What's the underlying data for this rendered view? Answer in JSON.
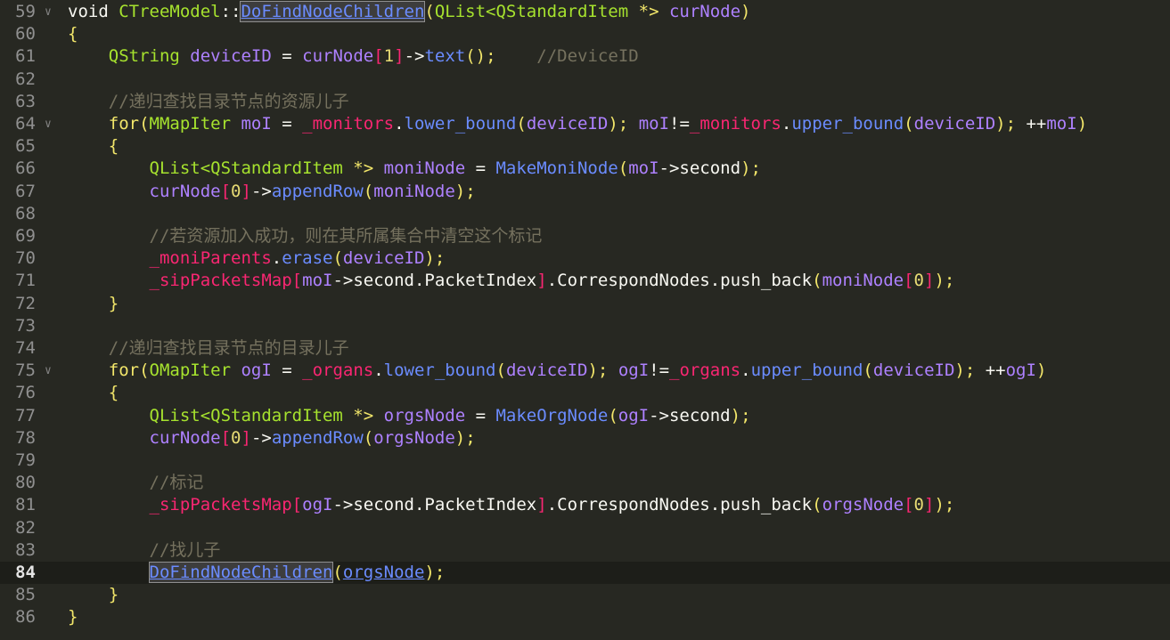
{
  "current_line": 84,
  "lines": [
    {
      "n": "59",
      "fold": true,
      "tokens": [
        [
          "kw",
          "void "
        ],
        [
          "type",
          "CTreeModel"
        ],
        [
          "op",
          "::"
        ],
        [
          "sel",
          "DoFindNodeChildren"
        ],
        [
          "flow",
          "("
        ],
        [
          "type",
          "QList<QStandardItem "
        ],
        [
          "flow",
          "*> "
        ],
        [
          "var",
          "curNode"
        ],
        [
          "flow",
          ")"
        ]
      ]
    },
    {
      "n": "60",
      "tokens": [
        [
          "flow",
          "{"
        ]
      ]
    },
    {
      "n": "61",
      "tokens": [
        [
          "plain",
          "    "
        ],
        [
          "type",
          "QString "
        ],
        [
          "var",
          "deviceID"
        ],
        [
          "op",
          " = "
        ],
        [
          "var",
          "curNode"
        ],
        [
          "mem",
          "["
        ],
        [
          "num",
          "1"
        ],
        [
          "mem",
          "]"
        ],
        [
          "op",
          "->"
        ],
        [
          "fn",
          "text"
        ],
        [
          "flow",
          "();"
        ],
        [
          "cm",
          "    //DeviceID"
        ]
      ]
    },
    {
      "n": "62",
      "tokens": []
    },
    {
      "n": "63",
      "tokens": [
        [
          "plain",
          "    "
        ],
        [
          "cm",
          "//递归查找目录节点的资源儿子"
        ]
      ]
    },
    {
      "n": "64",
      "fold": true,
      "tokens": [
        [
          "plain",
          "    "
        ],
        [
          "flow",
          "for("
        ],
        [
          "type",
          "MMapIter "
        ],
        [
          "var",
          "moI"
        ],
        [
          "op",
          " = "
        ],
        [
          "mem",
          "_monitors"
        ],
        [
          "op",
          "."
        ],
        [
          "fn",
          "lower_bound"
        ],
        [
          "flow",
          "("
        ],
        [
          "var",
          "deviceID"
        ],
        [
          "flow",
          ");"
        ],
        [
          "op",
          " "
        ],
        [
          "var",
          "moI"
        ],
        [
          "op",
          "!="
        ],
        [
          "mem",
          "_monitors"
        ],
        [
          "op",
          "."
        ],
        [
          "fn",
          "upper_bound"
        ],
        [
          "flow",
          "("
        ],
        [
          "var",
          "deviceID"
        ],
        [
          "flow",
          ");"
        ],
        [
          "op",
          " ++"
        ],
        [
          "var",
          "moI"
        ],
        [
          "flow",
          ")"
        ]
      ]
    },
    {
      "n": "65",
      "tokens": [
        [
          "plain",
          "    "
        ],
        [
          "flow",
          "{"
        ]
      ]
    },
    {
      "n": "66",
      "tokens": [
        [
          "plain",
          "        "
        ],
        [
          "type",
          "QList<QStandardItem "
        ],
        [
          "flow",
          "*> "
        ],
        [
          "var",
          "moniNode"
        ],
        [
          "op",
          " = "
        ],
        [
          "fn",
          "MakeMoniNode"
        ],
        [
          "flow",
          "("
        ],
        [
          "var",
          "moI"
        ],
        [
          "op",
          "->"
        ],
        [
          "plain",
          "second"
        ],
        [
          "flow",
          ");"
        ]
      ]
    },
    {
      "n": "67",
      "tokens": [
        [
          "plain",
          "        "
        ],
        [
          "var",
          "curNode"
        ],
        [
          "mem",
          "["
        ],
        [
          "num",
          "0"
        ],
        [
          "mem",
          "]"
        ],
        [
          "op",
          "->"
        ],
        [
          "fn",
          "appendRow"
        ],
        [
          "flow",
          "("
        ],
        [
          "var",
          "moniNode"
        ],
        [
          "flow",
          ");"
        ]
      ]
    },
    {
      "n": "68",
      "tokens": []
    },
    {
      "n": "69",
      "tokens": [
        [
          "plain",
          "        "
        ],
        [
          "cm",
          "//若资源加入成功，则在其所属集合中清空这个标记"
        ]
      ]
    },
    {
      "n": "70",
      "tokens": [
        [
          "plain",
          "        "
        ],
        [
          "mem",
          "_moniParents"
        ],
        [
          "op",
          "."
        ],
        [
          "fn",
          "erase"
        ],
        [
          "flow",
          "("
        ],
        [
          "var",
          "deviceID"
        ],
        [
          "flow",
          ");"
        ]
      ]
    },
    {
      "n": "71",
      "tokens": [
        [
          "plain",
          "        "
        ],
        [
          "mem",
          "_sipPacketsMap"
        ],
        [
          "mem",
          "["
        ],
        [
          "var",
          "moI"
        ],
        [
          "op",
          "->"
        ],
        [
          "plain",
          "second.PacketIndex"
        ],
        [
          "mem",
          "]"
        ],
        [
          "plain",
          ".CorrespondNodes.push_back"
        ],
        [
          "flow",
          "("
        ],
        [
          "var",
          "moniNode"
        ],
        [
          "mem",
          "["
        ],
        [
          "num",
          "0"
        ],
        [
          "mem",
          "]"
        ],
        [
          "flow",
          ");"
        ]
      ]
    },
    {
      "n": "72",
      "tokens": [
        [
          "plain",
          "    "
        ],
        [
          "flow",
          "}"
        ]
      ]
    },
    {
      "n": "73",
      "tokens": []
    },
    {
      "n": "74",
      "tokens": [
        [
          "plain",
          "    "
        ],
        [
          "cm",
          "//递归查找目录节点的目录儿子"
        ]
      ]
    },
    {
      "n": "75",
      "fold": true,
      "tokens": [
        [
          "plain",
          "    "
        ],
        [
          "flow",
          "for("
        ],
        [
          "type",
          "OMapIter "
        ],
        [
          "var",
          "ogI"
        ],
        [
          "op",
          " = "
        ],
        [
          "mem",
          "_organs"
        ],
        [
          "op",
          "."
        ],
        [
          "fn",
          "lower_bound"
        ],
        [
          "flow",
          "("
        ],
        [
          "var",
          "deviceID"
        ],
        [
          "flow",
          ");"
        ],
        [
          "op",
          " "
        ],
        [
          "var",
          "ogI"
        ],
        [
          "op",
          "!="
        ],
        [
          "mem",
          "_organs"
        ],
        [
          "op",
          "."
        ],
        [
          "fn",
          "upper_bound"
        ],
        [
          "flow",
          "("
        ],
        [
          "var",
          "deviceID"
        ],
        [
          "flow",
          ");"
        ],
        [
          "op",
          " ++"
        ],
        [
          "var",
          "ogI"
        ],
        [
          "flow",
          ")"
        ]
      ]
    },
    {
      "n": "76",
      "tokens": [
        [
          "plain",
          "    "
        ],
        [
          "flow",
          "{"
        ]
      ]
    },
    {
      "n": "77",
      "tokens": [
        [
          "plain",
          "        "
        ],
        [
          "type",
          "QList<QStandardItem "
        ],
        [
          "flow",
          "*> "
        ],
        [
          "var",
          "orgsNode"
        ],
        [
          "op",
          " = "
        ],
        [
          "fn",
          "MakeOrgNode"
        ],
        [
          "flow",
          "("
        ],
        [
          "var",
          "ogI"
        ],
        [
          "op",
          "->"
        ],
        [
          "plain",
          "second"
        ],
        [
          "flow",
          ");"
        ]
      ]
    },
    {
      "n": "78",
      "tokens": [
        [
          "plain",
          "        "
        ],
        [
          "var",
          "curNode"
        ],
        [
          "mem",
          "["
        ],
        [
          "num",
          "0"
        ],
        [
          "mem",
          "]"
        ],
        [
          "op",
          "->"
        ],
        [
          "fn",
          "appendRow"
        ],
        [
          "flow",
          "("
        ],
        [
          "var",
          "orgsNode"
        ],
        [
          "flow",
          ");"
        ]
      ]
    },
    {
      "n": "79",
      "tokens": []
    },
    {
      "n": "80",
      "tokens": [
        [
          "plain",
          "        "
        ],
        [
          "cm",
          "//标记"
        ]
      ]
    },
    {
      "n": "81",
      "tokens": [
        [
          "plain",
          "        "
        ],
        [
          "mem",
          "_sipPacketsMap"
        ],
        [
          "mem",
          "["
        ],
        [
          "var",
          "ogI"
        ],
        [
          "op",
          "->"
        ],
        [
          "plain",
          "second.PacketIndex"
        ],
        [
          "mem",
          "]"
        ],
        [
          "plain",
          ".CorrespondNodes.push_back"
        ],
        [
          "flow",
          "("
        ],
        [
          "var",
          "orgsNode"
        ],
        [
          "mem",
          "["
        ],
        [
          "num",
          "0"
        ],
        [
          "mem",
          "]"
        ],
        [
          "flow",
          ");"
        ]
      ]
    },
    {
      "n": "82",
      "tokens": []
    },
    {
      "n": "83",
      "tokens": [
        [
          "plain",
          "        "
        ],
        [
          "cm",
          "//找儿子"
        ]
      ]
    },
    {
      "n": "84",
      "tokens": [
        [
          "plain",
          "        "
        ],
        [
          "sel",
          "DoFindNodeChildren"
        ],
        [
          "flow",
          "("
        ],
        [
          "link",
          "orgsNode"
        ],
        [
          "flow",
          ");"
        ]
      ]
    },
    {
      "n": "85",
      "tokens": [
        [
          "plain",
          "    "
        ],
        [
          "flow",
          "}"
        ]
      ]
    },
    {
      "n": "86",
      "tokens": [
        [
          "flow",
          "}"
        ]
      ]
    }
  ]
}
